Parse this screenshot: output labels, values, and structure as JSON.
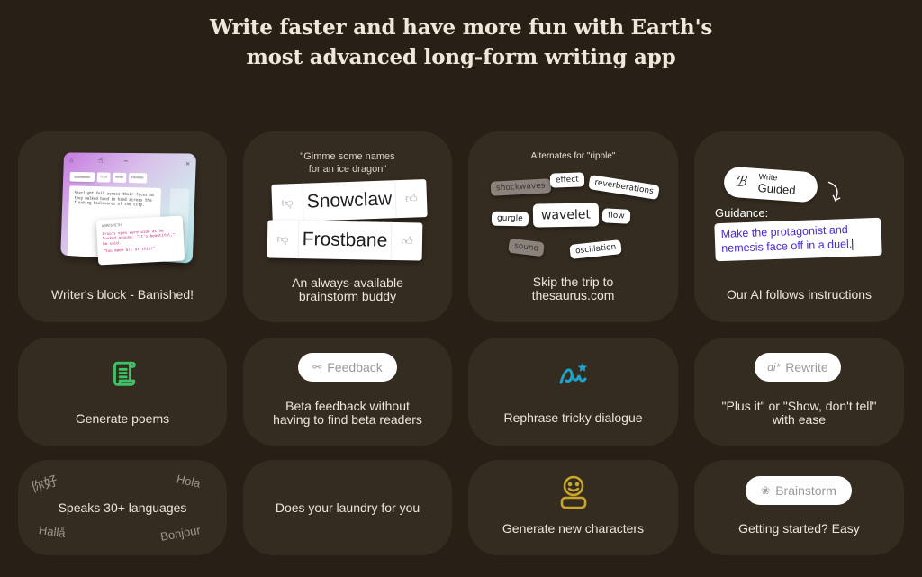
{
  "headline": {
    "line1": "Write faster and have more fun with Earth's",
    "line2": "most advanced long-form writing app"
  },
  "cards": [
    {
      "caption": "Writer's block - Banished!",
      "illustration": {
        "tabs": [
          "Wordsmith",
          "Tl;Dr",
          "Write",
          "Rewrite"
        ],
        "document_text": "Starlight fell across their faces as they walked hand in hand across the floating boulevards of the city.",
        "popup_header": "WORDSMITH",
        "popup_text": "Arno's eyes were wide as he looked around. \"It's beautiful,\" he said.",
        "popup_quote": "\"You made all of this!\""
      }
    },
    {
      "caption_line1": "An always-available",
      "caption_line2": "brainstorm buddy",
      "prompt_line1": "\"Gimme some names",
      "prompt_line2": "for an ice dragon\"",
      "names": [
        "Snowclaw",
        "Frostbane"
      ]
    },
    {
      "caption_line1": "Skip the trip to",
      "caption_line2": "thesaurus.com",
      "title": "Alternates for \"ripple\"",
      "words": [
        "shockwaves",
        "effect",
        "reverberations",
        "gurgle",
        "wavelet",
        "flow",
        "sound",
        "oscillation"
      ]
    },
    {
      "caption": "Our AI follows instructions",
      "button_line1": "Write",
      "button_line2": "Guided",
      "guidance_label": "Guidance:",
      "guidance_text": "Make the protagonist and nemesis face off in a duel."
    },
    {
      "caption": "Generate poems",
      "icon": "scroll-icon",
      "icon_color": "#3ec266"
    },
    {
      "caption_line1": "Beta feedback without",
      "caption_line2": "having to find beta readers",
      "pill_label": "Feedback",
      "pill_icon": "glasses-icon"
    },
    {
      "caption": "Rephrase tricky dialogue",
      "icon": "ai-sparkle-icon",
      "icon_color": "#1fa3c9"
    },
    {
      "caption_line1": "\"Plus it\" or \"Show, don't tell\"",
      "caption_line2": "with ease",
      "pill_label": "Rewrite",
      "pill_icon": "ai-sparkle-icon"
    },
    {
      "caption": "Speaks 30+ languages",
      "greetings": [
        "你好",
        "Hola",
        "Hallå",
        "Bonjour"
      ]
    },
    {
      "caption": "Does your laundry for you"
    },
    {
      "caption": "Generate new characters",
      "icon": "character-icon",
      "icon_color": "#c9a52b"
    },
    {
      "caption": "Getting started? Easy",
      "pill_label": "Brainstorm",
      "pill_icon": "brain-icon"
    }
  ],
  "colors": {
    "background": "#272017",
    "card": "#352c21",
    "guidance_text": "#4c2bd0"
  }
}
